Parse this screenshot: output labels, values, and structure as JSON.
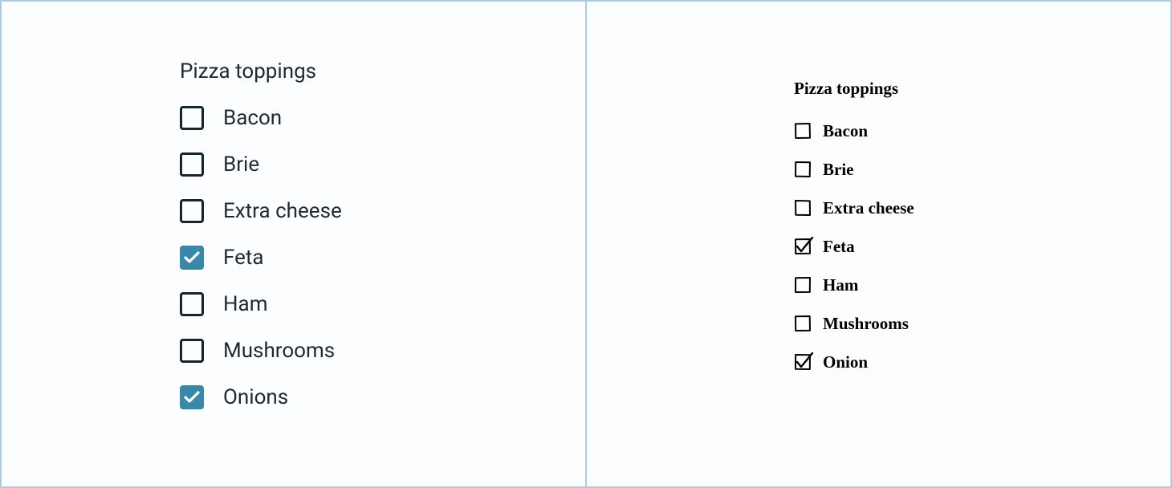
{
  "panels": {
    "polished": {
      "heading": "Pizza toppings",
      "options": [
        {
          "label": "Bacon",
          "checked": false
        },
        {
          "label": "Brie",
          "checked": false
        },
        {
          "label": "Extra cheese",
          "checked": false
        },
        {
          "label": "Feta",
          "checked": true
        },
        {
          "label": "Ham",
          "checked": false
        },
        {
          "label": "Mushrooms",
          "checked": false
        },
        {
          "label": "Onions",
          "checked": true
        }
      ]
    },
    "sketchy": {
      "heading": "Pizza toppings",
      "options": [
        {
          "label": "Bacon",
          "checked": false
        },
        {
          "label": "Brie",
          "checked": false
        },
        {
          "label": "Extra cheese",
          "checked": false
        },
        {
          "label": "Feta",
          "checked": true
        },
        {
          "label": "Ham",
          "checked": false
        },
        {
          "label": "Mushrooms",
          "checked": false
        },
        {
          "label": "Onion",
          "checked": true
        }
      ]
    }
  },
  "colors": {
    "border": "#a9cce0",
    "checkbox_fill": "#3889a7",
    "text": "#1e2a33"
  }
}
